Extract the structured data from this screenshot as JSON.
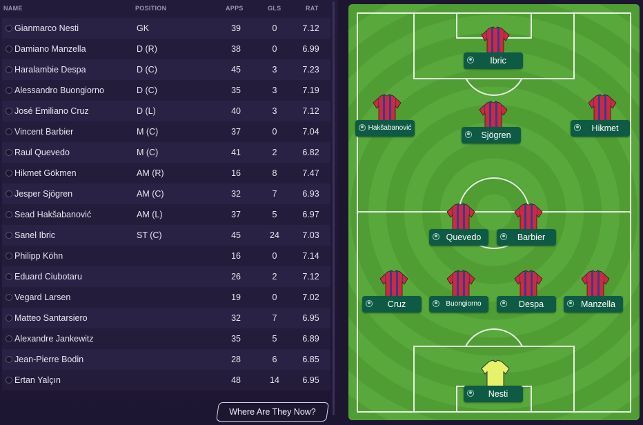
{
  "table": {
    "headers": {
      "name": "NAME",
      "position": "POSITION",
      "apps": "APPS",
      "gls": "GLS",
      "rat": "RAT"
    },
    "rows": [
      {
        "name": "Gianmarco Nesti",
        "position": "GK",
        "apps": "39",
        "gls": "0",
        "rat": "7.12"
      },
      {
        "name": "Damiano Manzella",
        "position": "D (R)",
        "apps": "38",
        "gls": "0",
        "rat": "6.99"
      },
      {
        "name": "Haralambie Despa",
        "position": "D (C)",
        "apps": "45",
        "gls": "3",
        "rat": "7.23"
      },
      {
        "name": "Alessandro Buongiorno",
        "position": "D (C)",
        "apps": "35",
        "gls": "3",
        "rat": "7.19"
      },
      {
        "name": "José Emiliano Cruz",
        "position": "D (L)",
        "apps": "40",
        "gls": "3",
        "rat": "7.12"
      },
      {
        "name": "Vincent Barbier",
        "position": "M (C)",
        "apps": "37",
        "gls": "0",
        "rat": "7.04"
      },
      {
        "name": "Raul Quevedo",
        "position": "M (C)",
        "apps": "41",
        "gls": "2",
        "rat": "6.82"
      },
      {
        "name": "Hikmet Gökmen",
        "position": "AM (R)",
        "apps": "16",
        "gls": "8",
        "rat": "7.47"
      },
      {
        "name": "Jesper Sjögren",
        "position": "AM (C)",
        "apps": "32",
        "gls": "7",
        "rat": "6.93"
      },
      {
        "name": "Sead Hakšabanović",
        "position": "AM (L)",
        "apps": "37",
        "gls": "5",
        "rat": "6.97"
      },
      {
        "name": "Sanel Ibric",
        "position": "ST (C)",
        "apps": "45",
        "gls": "24",
        "rat": "7.03"
      },
      {
        "name": "Philipp Köhn",
        "position": "",
        "apps": "16",
        "gls": "0",
        "rat": "7.14"
      },
      {
        "name": "Eduard Ciubotaru",
        "position": "",
        "apps": "26",
        "gls": "2",
        "rat": "7.12"
      },
      {
        "name": "Vegard Larsen",
        "position": "",
        "apps": "19",
        "gls": "0",
        "rat": "7.02"
      },
      {
        "name": "Matteo Santarsiero",
        "position": "",
        "apps": "32",
        "gls": "7",
        "rat": "6.95"
      },
      {
        "name": "Alexandre Jankewitz",
        "position": "",
        "apps": "35",
        "gls": "5",
        "rat": "6.89"
      },
      {
        "name": "Jean-Pierre Bodin",
        "position": "",
        "apps": "28",
        "gls": "6",
        "rat": "6.85"
      },
      {
        "name": "Ertan Yalçın",
        "position": "",
        "apps": "48",
        "gls": "14",
        "rat": "6.95"
      }
    ]
  },
  "button": {
    "where_are_they_now": "Where Are They Now?"
  },
  "pitch": {
    "players": [
      {
        "id": "ibric",
        "label": "Ibric",
        "kit": "outfield",
        "small": false
      },
      {
        "id": "haksabanovic",
        "label": "Hakšabanović",
        "kit": "outfield",
        "small": true
      },
      {
        "id": "sjogren",
        "label": "Sjögren",
        "kit": "outfield",
        "small": false
      },
      {
        "id": "hikmet",
        "label": "Hikmet",
        "kit": "outfield",
        "small": false
      },
      {
        "id": "quevedo",
        "label": "Quevedo",
        "kit": "outfield",
        "small": false
      },
      {
        "id": "barbier",
        "label": "Barbier",
        "kit": "outfield",
        "small": false
      },
      {
        "id": "cruz",
        "label": "Cruz",
        "kit": "outfield",
        "small": false
      },
      {
        "id": "buongiorno",
        "label": "Buongiorno",
        "kit": "outfield",
        "small": true
      },
      {
        "id": "despa",
        "label": "Despa",
        "kit": "outfield",
        "small": false
      },
      {
        "id": "manzella",
        "label": "Manzella",
        "kit": "outfield",
        "small": false
      },
      {
        "id": "nesti",
        "label": "Nesti",
        "kit": "goalkeeper",
        "small": false
      }
    ]
  },
  "colors": {
    "kit_red": "#d2283a",
    "kit_blue": "#2b3f9e",
    "gk_yellow": "#e6f36a",
    "label_green": "#0f5a44",
    "pitch_green": "#59a83b"
  }
}
